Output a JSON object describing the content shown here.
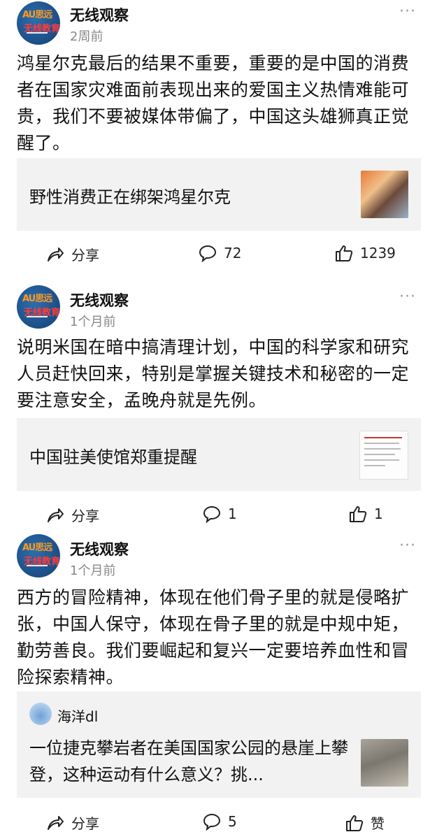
{
  "posts": [
    {
      "author": "无线观察",
      "time": "2周前",
      "content": "鸿星尔克最后的结果不重要，重要的是中国的消费者在国家灾难面前表现出来的爱国主义热情难能可贵，我们不要被媒体带偏了，中国这头雄狮真正觉醒了。",
      "card_title": "野性消费正在绑架鸿星尔克",
      "share_label": "分享",
      "comment_count": "72",
      "like_count": "1239"
    },
    {
      "author": "无线观察",
      "time": "1个月前",
      "content": "说明米国在暗中搞清理计划，中国的科学家和研究人员赶快回来，特别是掌握关键技术和秘密的一定要注意安全，孟晚舟就是先例。",
      "card_title": "中国驻美使馆郑重提醒",
      "share_label": "分享",
      "comment_count": "1",
      "like_count": "1"
    },
    {
      "author": "无线观察",
      "time": "1个月前",
      "content": "西方的冒险精神，体现在他们骨子里的就是侵略扩张，中国人保守，体现在骨子里的就是中规中矩，勤劳善良。我们要崛起和复兴一定要培养血性和冒险探索精神。",
      "quote_author": "海洋dl",
      "quote_text": "一位捷克攀岩者在美国国家公园的悬崖上攀登，这种运动有什么意义？挑...",
      "share_label": "分享",
      "comment_count": "5",
      "like_label": "赞"
    }
  ],
  "more_glyph": "···",
  "icons": [
    "share-icon",
    "comment-icon",
    "like-icon",
    "more-icon"
  ]
}
